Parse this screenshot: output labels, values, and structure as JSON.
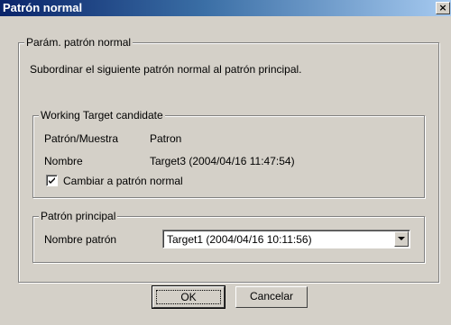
{
  "window": {
    "title": "Patrón normal",
    "close_glyph": "×"
  },
  "outer_group": {
    "legend": "Parám. patrón normal",
    "description": "Subordinar el siguiente patrón normal al patrón principal."
  },
  "candidate_group": {
    "legend": "Working Target candidate",
    "rows": [
      {
        "label": "Patrón/Muestra",
        "value": "Patron"
      },
      {
        "label": "Nombre",
        "value": "Target3 (2004/04/16 11:47:54)"
      }
    ],
    "checkbox_label": "Cambiar a patrón normal",
    "checkbox_checked": true
  },
  "principal_group": {
    "legend": "Patrón principal",
    "field_label": "Nombre patrón",
    "selected_value": "Target1 (2004/04/16 10:11:56)"
  },
  "buttons": {
    "ok_label": "OK",
    "cancel_label": "Cancelar"
  },
  "icons": {
    "close": "close-icon",
    "check": "checkmark-icon",
    "dropdown": "chevron-down-icon"
  }
}
